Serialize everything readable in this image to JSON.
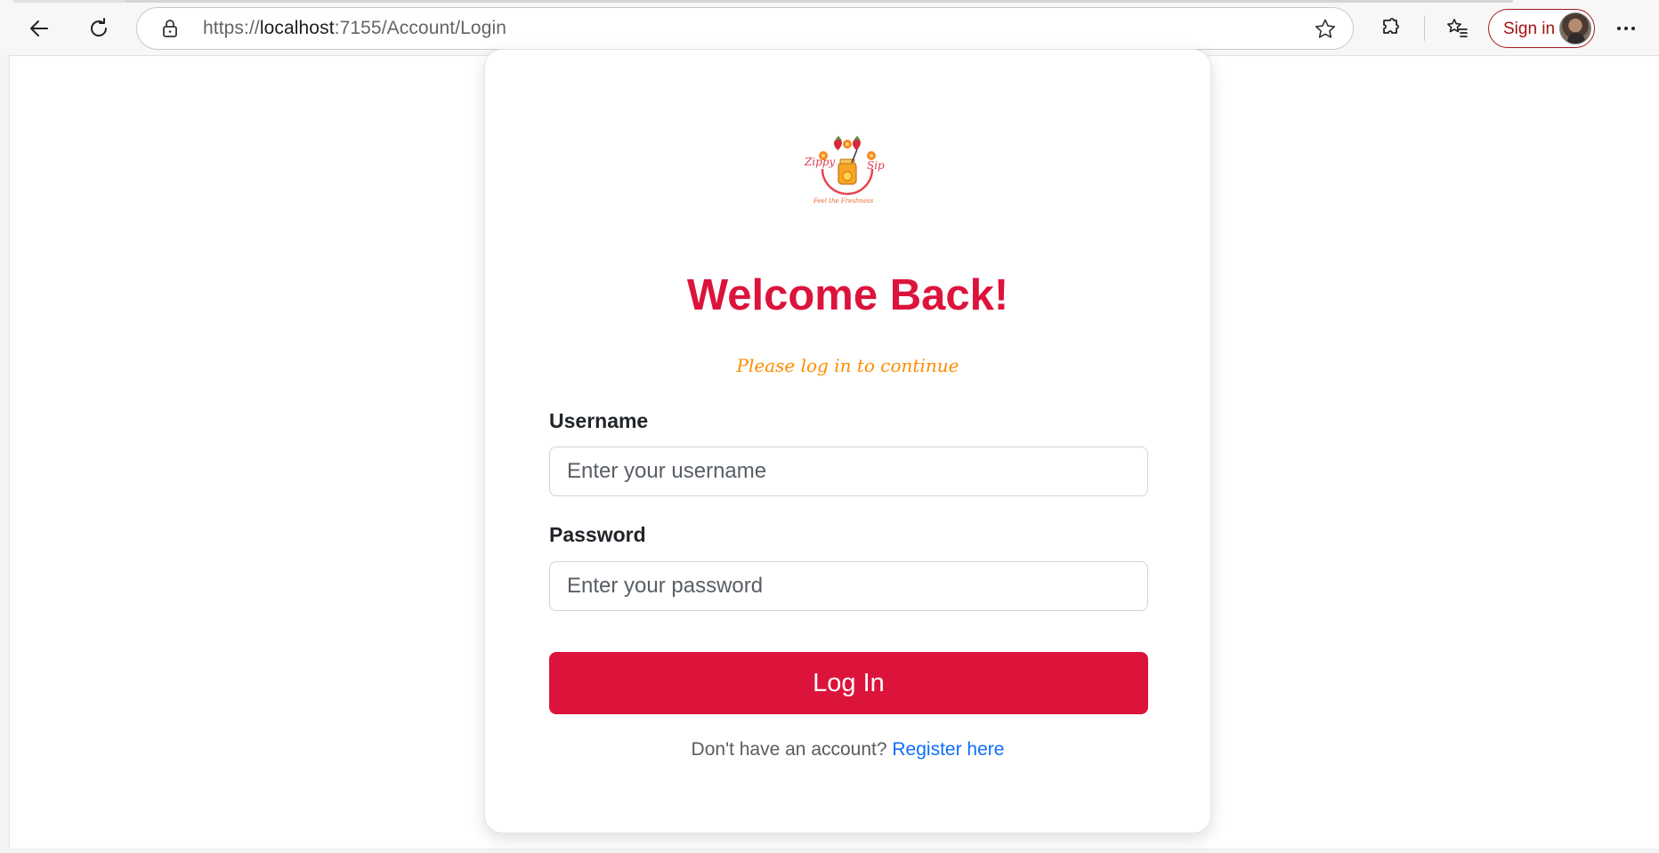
{
  "browser": {
    "url_scheme": "https://",
    "url_host": "localhost",
    "url_path": ":7155/Account/Login",
    "sign_in_label": "Sign in"
  },
  "page": {
    "title": "Welcome Back!",
    "subtitle": "Please log in to continue",
    "username_label": "Username",
    "username_placeholder": "Enter your username",
    "username_value": "",
    "password_label": "Password",
    "password_placeholder": "Enter your password",
    "password_value": "",
    "login_label": "Log In",
    "register_prompt": "Don't have an account?",
    "register_link": "Register here"
  },
  "logo": {
    "brand_left": "Zippy",
    "brand_right": "Sip",
    "tagline": "Feel the Freshness"
  },
  "colors": {
    "accent": "#dc143c",
    "subtitle": "#ff8c00",
    "link": "#0d6efd"
  },
  "icons": [
    "back-arrow-icon",
    "refresh-icon",
    "lock-icon",
    "favorite-star-icon",
    "extensions-icon",
    "favorites-icon",
    "more-icon"
  ]
}
